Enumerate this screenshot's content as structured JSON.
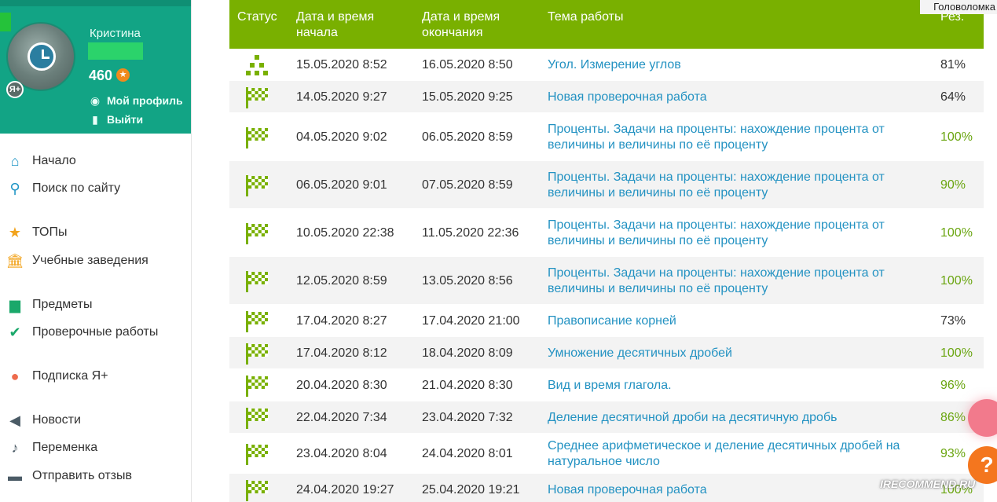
{
  "window": {
    "top_right_label": "Головоломка"
  },
  "profile": {
    "name": "Кристина",
    "points": "460",
    "links": [
      {
        "label": "Мой профиль",
        "icon": "user-circle-icon"
      },
      {
        "label": "Выйти",
        "icon": "exit-icon"
      }
    ],
    "badge": "Я+"
  },
  "nav": [
    {
      "label": "Начало",
      "icon": "home-icon",
      "color": "#2196c6"
    },
    {
      "label": "Поиск по сайту",
      "icon": "search-icon",
      "color": "#2196c6"
    },
    {
      "label": "ТОПы",
      "icon": "star-icon",
      "color": "#f2a31b"
    },
    {
      "label": "Учебные заведения",
      "icon": "school-icon",
      "color": "#f2a31b"
    },
    {
      "label": "Предметы",
      "icon": "book-icon",
      "color": "#1aa86a"
    },
    {
      "label": "Проверочные работы",
      "icon": "check-circle-icon",
      "color": "#1aa86a"
    },
    {
      "label": "Подписка Я+",
      "icon": "subscription-icon",
      "color": "#ee6b4d"
    },
    {
      "label": "Новости",
      "icon": "megaphone-icon",
      "color": "#4b5b66"
    },
    {
      "label": "Переменка",
      "icon": "bell-icon",
      "color": "#4b5b66"
    },
    {
      "label": "Отправить отзыв",
      "icon": "feedback-icon",
      "color": "#4b5b66"
    }
  ],
  "table": {
    "headers": {
      "status": "Статус",
      "start_line1": "Дата и время",
      "start_line2": "начала",
      "end_line1": "Дата и время",
      "end_line2": "окончания",
      "topic": "Тема работы",
      "result": "Рез."
    },
    "rows": [
      {
        "status": "tree-icon",
        "start": "15.05.2020 8:52",
        "end": "16.05.2020 8:50",
        "topic1": "Угол. Измерение углов",
        "topic2": "",
        "result": "81%",
        "full": false
      },
      {
        "status": "finish-flag-icon",
        "start": "14.05.2020 9:27",
        "end": "15.05.2020 9:25",
        "topic1": "Новая проверочная работа",
        "topic2": "",
        "result": "64%",
        "full": false
      },
      {
        "status": "finish-flag-icon",
        "start": "04.05.2020 9:02",
        "end": "06.05.2020 8:59",
        "topic1": "Проценты. Задачи на проценты: нахождение процента от",
        "topic2": "величины и величины по её проценту",
        "result": "100%",
        "full": true
      },
      {
        "status": "finish-flag-icon",
        "start": "06.05.2020 9:01",
        "end": "07.05.2020 8:59",
        "topic1": "Проценты. Задачи на проценты: нахождение процента от",
        "topic2": "величины и величины по её проценту",
        "result": "90%",
        "full": true
      },
      {
        "status": "finish-flag-icon",
        "start": "10.05.2020 22:38",
        "end": "11.05.2020 22:36",
        "topic1": "Проценты. Задачи на проценты: нахождение процента от",
        "topic2": "величины и величины по её проценту",
        "result": "100%",
        "full": true
      },
      {
        "status": "finish-flag-icon",
        "start": "12.05.2020 8:59",
        "end": "13.05.2020 8:56",
        "topic1": "Проценты. Задачи на проценты: нахождение процента от",
        "topic2": "величины и величины по её проценту",
        "result": "100%",
        "full": true
      },
      {
        "status": "finish-flag-icon",
        "start": "17.04.2020 8:27",
        "end": "17.04.2020 21:00",
        "topic1": "Правописание корней",
        "topic2": "",
        "result": "73%",
        "full": false
      },
      {
        "status": "finish-flag-icon",
        "start": "17.04.2020 8:12",
        "end": "18.04.2020 8:09",
        "topic1": "Умножение десятичных дробей",
        "topic2": "",
        "result": "100%",
        "full": true
      },
      {
        "status": "finish-flag-icon",
        "start": "20.04.2020 8:30",
        "end": "21.04.2020 8:30",
        "topic1": "Вид и время глагола.",
        "topic2": "",
        "result": "96%",
        "full": true
      },
      {
        "status": "finish-flag-icon",
        "start": "22.04.2020 7:34",
        "end": "23.04.2020 7:32",
        "topic1": "Деление десятичной дроби на десятичную дробь",
        "topic2": "",
        "result": "86%",
        "full": true
      },
      {
        "status": "finish-flag-icon",
        "start": "23.04.2020 8:04",
        "end": "24.04.2020 8:01",
        "topic1": "Среднее арифметическое и деление десятичных дробей на",
        "topic2": "натуральное число",
        "result": "93%",
        "full": true
      },
      {
        "status": "finish-flag-icon",
        "start": "24.04.2020 19:27",
        "end": "25.04.2020 19:21",
        "topic1": "Новая проверочная работа",
        "topic2": "",
        "result": "100%",
        "full": true
      }
    ]
  },
  "overlay": {
    "help_symbol": "?",
    "watermark": "IRECOMMEND.RU"
  },
  "colors": {
    "header": "#79b000",
    "profile_bg": "#12a485",
    "link": "#2392c2",
    "good_result": "#6aa510"
  }
}
